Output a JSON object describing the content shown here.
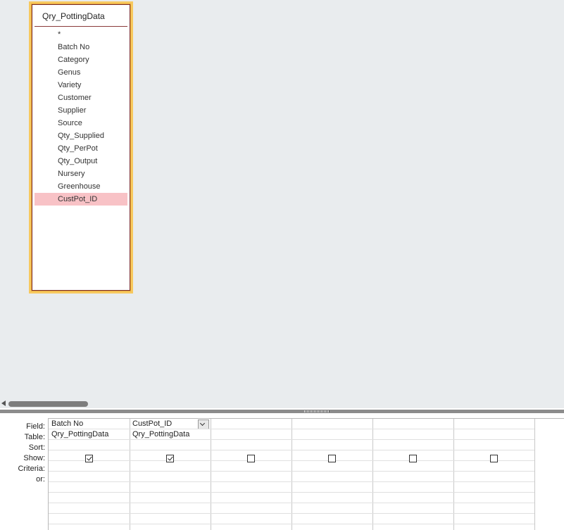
{
  "table_box": {
    "title": "Qry_PottingData",
    "fields": [
      "*",
      "Batch No",
      "Category",
      "Genus",
      "Variety",
      "Customer",
      "Supplier",
      "Source",
      "Qty_Supplied",
      "Qty_PerPot",
      "Qty_Output",
      "Nursery",
      "Greenhouse",
      "CustPot_ID"
    ],
    "selected_field": "CustPot_ID"
  },
  "qbe": {
    "row_labels": {
      "field": "Field:",
      "table": "Table:",
      "sort": "Sort:",
      "show": "Show:",
      "criteria": "Criteria:",
      "or": "or:"
    },
    "columns": [
      {
        "field": "Batch No",
        "table": "Qry_PottingData",
        "show": true
      },
      {
        "field": "CustPot_ID",
        "table": "Qry_PottingData",
        "show": true
      },
      {
        "field": "",
        "table": "",
        "show": false
      },
      {
        "field": "",
        "table": "",
        "show": false
      },
      {
        "field": "",
        "table": "",
        "show": false
      },
      {
        "field": "",
        "table": "",
        "show": false
      }
    ]
  }
}
